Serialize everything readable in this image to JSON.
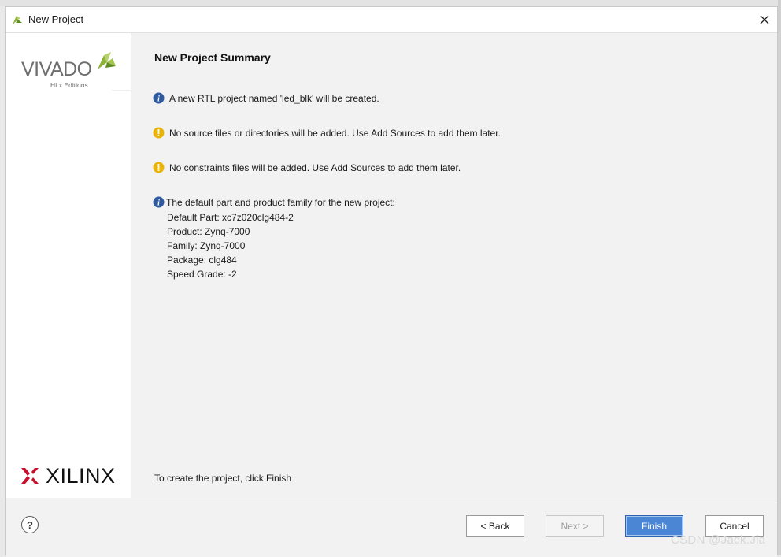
{
  "window": {
    "title": "New Project",
    "title_icon": "vivado-leaf-icon",
    "close_icon": "close-icon"
  },
  "sidebar": {
    "vivado_logo_text": "VIVADO",
    "vivado_logo_sub": "HLx Editions",
    "xilinx_logo_text": "XILINX"
  },
  "main": {
    "heading": "New Project Summary",
    "messages": [
      {
        "icon": "info-icon",
        "text": "A new RTL project named 'led_blk' will be created."
      },
      {
        "icon": "warning-icon",
        "text": "No source files or directories will be added. Use Add Sources to add them later."
      },
      {
        "icon": "warning-icon",
        "text": "No constraints files will be added. Use Add Sources to add them later."
      },
      {
        "icon": "info-icon",
        "text": "The default part and product family for the new project:"
      }
    ],
    "details": [
      "Default Part: xc7z020clg484-2",
      "Product: Zynq-7000",
      "Family: Zynq-7000",
      "Package: clg484",
      "Speed Grade: -2"
    ],
    "footer_note": "To create the project, click Finish"
  },
  "buttons": {
    "help": "?",
    "back": "< Back",
    "next": "Next >",
    "finish": "Finish",
    "cancel": "Cancel"
  },
  "watermark": "CSDN @Jack.Jia",
  "colors": {
    "info": "#2f5a9e",
    "warning": "#e8b40c",
    "primary_button": "#4a86d4",
    "xilinx_red": "#c8102e",
    "vivado_green": "#8db33a"
  }
}
